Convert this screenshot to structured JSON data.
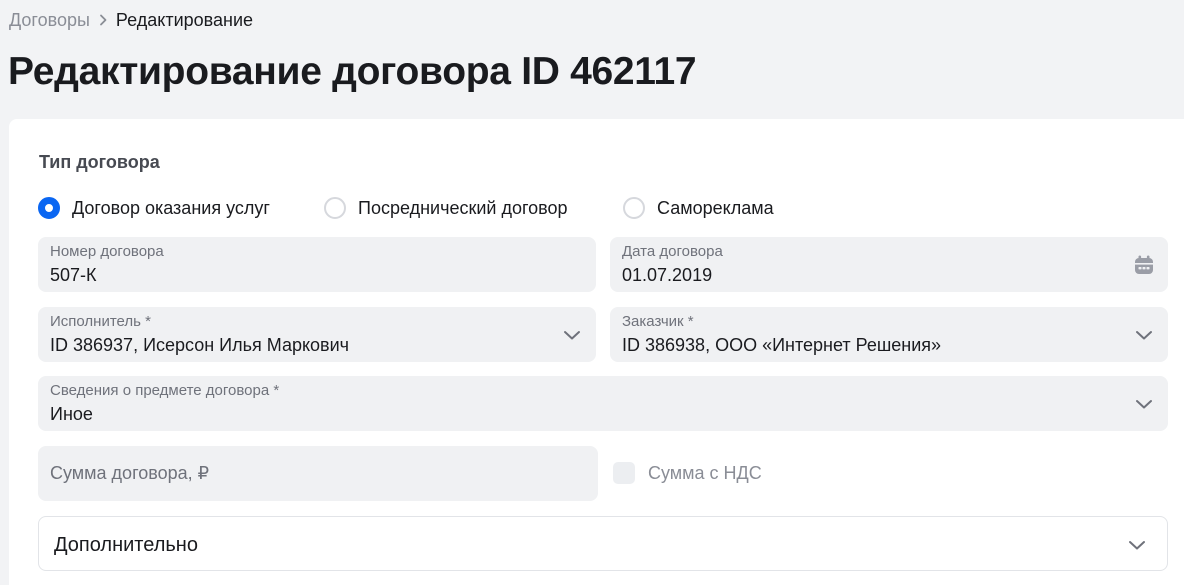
{
  "breadcrumb": {
    "items": [
      "Договоры",
      "Редактирование"
    ]
  },
  "page": {
    "title": "Редактирование договора ID 462117"
  },
  "form": {
    "contract_type": {
      "label": "Тип договора",
      "options": [
        {
          "label": "Договор оказания услуг",
          "checked": true
        },
        {
          "label": "Посреднический договор",
          "checked": false
        },
        {
          "label": "Самореклама",
          "checked": false
        }
      ]
    },
    "contract_number": {
      "label": "Номер договора",
      "value": "507-К"
    },
    "contract_date": {
      "label": "Дата договора",
      "value": "01.07.2019",
      "icon": "calendar-icon"
    },
    "executor": {
      "label": "Исполнитель *",
      "value": "ID 386937, Исерсон Илья Маркович",
      "icon": "chevron-down-icon"
    },
    "customer": {
      "label": "Заказчик *",
      "value": "ID 386938, ООО «Интернет Решения»",
      "icon": "chevron-down-icon"
    },
    "subject": {
      "label": "Сведения о предмете договора *",
      "value": "Иное",
      "icon": "chevron-down-icon"
    },
    "amount": {
      "placeholder": "Сумма договора, ₽"
    },
    "vat": {
      "label": "Сумма с НДС",
      "checked": false,
      "disabled": true
    },
    "additional": {
      "label": "Дополнительно",
      "icon": "chevron-down-icon"
    }
  },
  "colors": {
    "accent": "#0a66f2",
    "field_bg": "#f0f1f3",
    "page_bg": "#f2f3f5"
  }
}
